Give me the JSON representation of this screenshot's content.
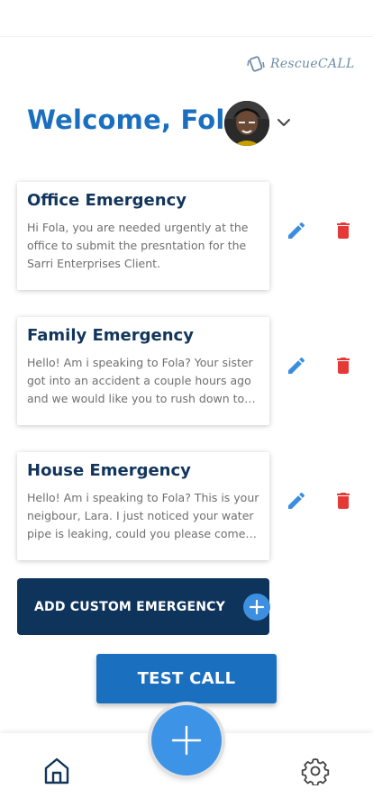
{
  "header": {
    "brand_name": "RescueCALL",
    "welcome_text": "Welcome, Fola"
  },
  "emergencies": [
    {
      "title": "Office Emergency",
      "message": "Hi Fola, you are needed urgently at the office to submit the presntation for the Sarri Enterprises Client."
    },
    {
      "title": "Family Emergency",
      "message": "Hello! Am i speaking to Fola? Your sister got into an accident a couple hours ago and we would like you to rush down to the hospital."
    },
    {
      "title": "House Emergency",
      "message": "Hello! Am i speaking to Fola? This is your neigbour, Lara. I just noticed your water pipe is leaking, could you please come home quickly?"
    }
  ],
  "actions": {
    "add_custom_label": "ADD CUSTOM EMERGENCY",
    "test_call_label": "TEST CALL"
  },
  "icons": {
    "brand": "rescuecall-logo-icon",
    "edit": "pencil-icon",
    "delete": "trash-icon",
    "add": "plus-icon",
    "home": "home-icon",
    "settings": "gear-icon",
    "dropdown": "chevron-down-icon"
  },
  "colors": {
    "primary_blue": "#1b6fbf",
    "navy": "#0f345c",
    "accent_blue": "#3d94e6",
    "delete_red": "#e53935",
    "edit_blue": "#3b8de0"
  }
}
